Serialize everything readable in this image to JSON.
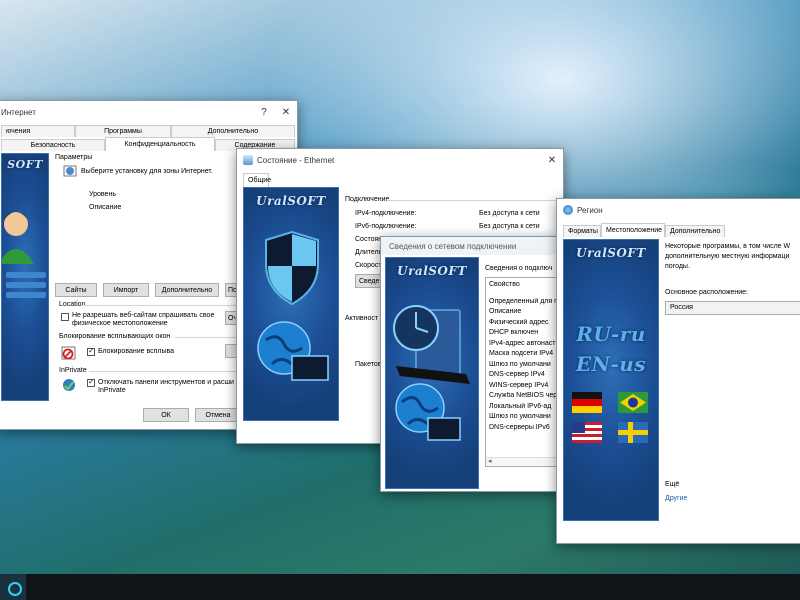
{
  "internet_options": {
    "title": "Интернет",
    "controls": [
      "?",
      "✕"
    ],
    "tabs_row1": [
      "ючения",
      "Программы",
      "Дополнительно"
    ],
    "tabs_row2": [
      "Безопасность",
      "Конфиденциальность",
      "Содержание"
    ],
    "params_label": "Параметры",
    "zone_text": "Выберите установку для зоны Интернет.",
    "level_label": "Уровень",
    "desc_label": "Описание",
    "buttons": [
      "Сайты",
      "Импорт",
      "Дополнительно",
      "По"
    ],
    "location_label": "Location",
    "location_check_line1": "Не разрешать веб-сайтам спрашивать свое",
    "location_check_line2": "физическое местоположение",
    "location_clear": "Оч",
    "popup_group": "Блокирование всплывающих окон",
    "popup_check": "Блокирование всплыва",
    "inprivate_group": "InPrivate",
    "inprivate_check_line1": "Отключать панели инструментов и расши",
    "inprivate_check_line2": "InPrivate",
    "ok": "ОК",
    "cancel": "Отмена"
  },
  "ethernet_status": {
    "title": "Состояние - Ethernet",
    "controls": [
      "✕"
    ],
    "tab": "Общие",
    "brand": "UralSOFT",
    "section": "Подключение",
    "rows": [
      {
        "label": "IPv4-подключение:",
        "value": "Без доступа к сети"
      },
      {
        "label": "IPv6-подключение:",
        "value": "Без доступа к сети"
      },
      {
        "label": "Состоян",
        "value": ""
      },
      {
        "label": "Длитель",
        "value": ""
      },
      {
        "label": "Скорост",
        "value": ""
      }
    ],
    "details_btn": "Сведе",
    "activity_label": "Активност",
    "packets_label": "Пакетов"
  },
  "network_details": {
    "title": "Сведения о сетевом подключении",
    "brand": "UralSOFT",
    "header": "Сведения о подключ",
    "list_header": "Свойство",
    "items": [
      "Определенный для п",
      "Описание",
      "Физический адрес",
      "DHCP включен",
      "IPv4-адрес автонаст",
      "Маска подсети IPv4",
      "Шлюз по умолчани",
      "DNS-сервер IPv4",
      "WINS-сервер IPv4",
      "Служба NetBIOS чер",
      "Локальный IPv6-ад",
      "Шлюз по умолчани",
      "DNS-серверы IPv6"
    ]
  },
  "region": {
    "title": "Регион",
    "tabs": [
      "Форматы",
      "Местоположение",
      "Дополнительно"
    ],
    "brand": "UralSOFT",
    "ru_text": "RU-ru",
    "en_text": "EN-us",
    "info_line1": "Некоторые программы, в том числе W",
    "info_line2": "дополнительную местную информаци",
    "info_line3": "погоды.",
    "home_label": "Основное расположение:",
    "home_value": "Россия",
    "more_label": "Ещё",
    "other_link": "Другие"
  },
  "colors": {
    "accent_blue": "#1c4f95",
    "link": "#1a5fb4"
  }
}
